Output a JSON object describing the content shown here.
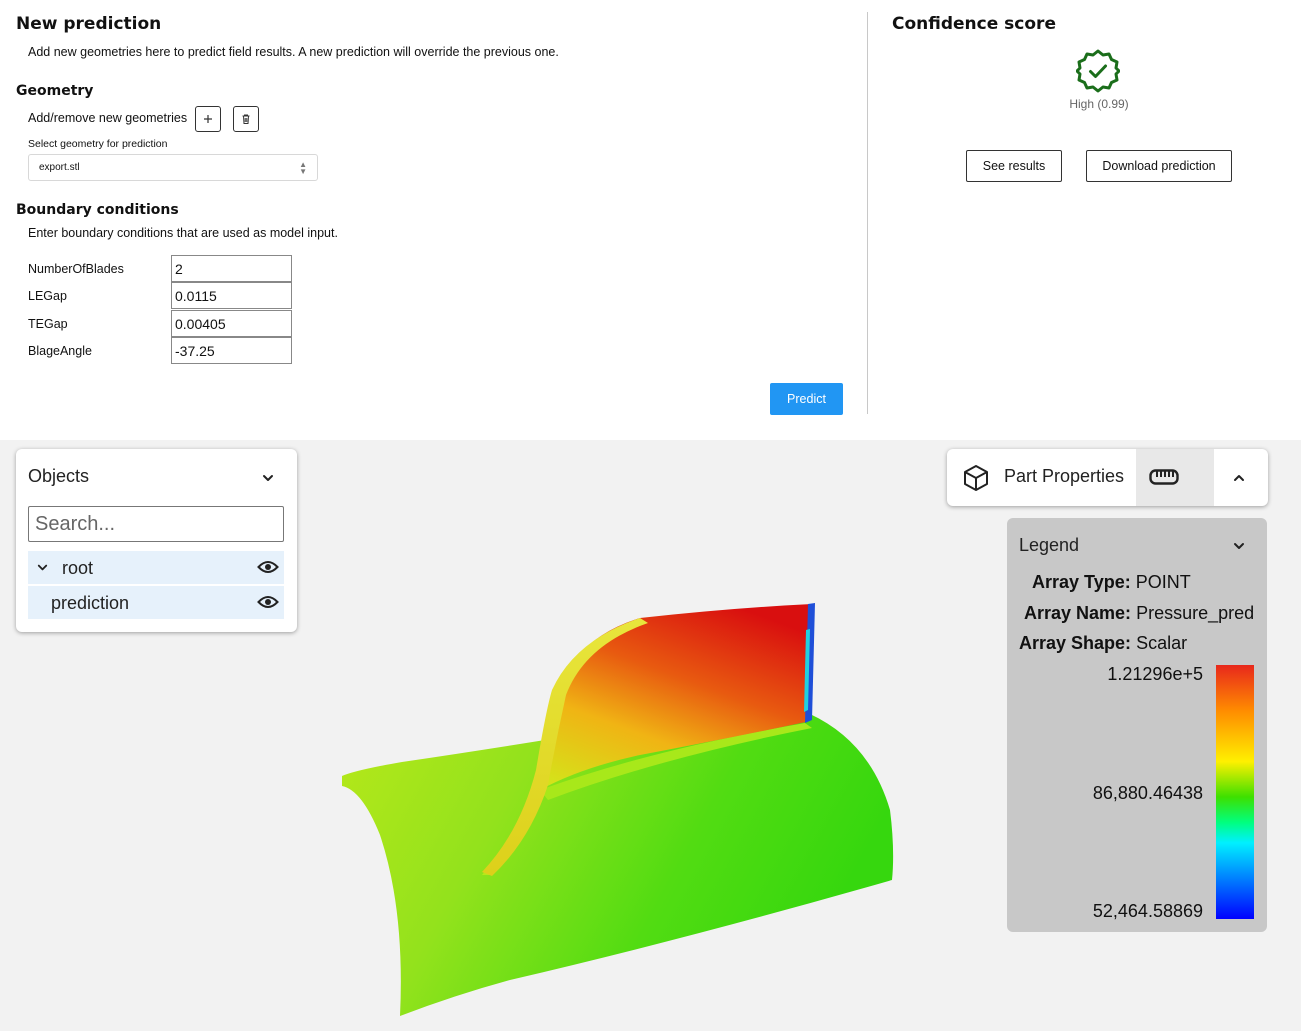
{
  "new_prediction": {
    "title": "New prediction",
    "description": "Add new geometries here to predict field results. A new prediction will override the previous one."
  },
  "geometry": {
    "title": "Geometry",
    "add_remove_label": "Add/remove new geometries",
    "add_icon": "plus-icon",
    "remove_icon": "trash-icon",
    "select_label": "Select geometry for prediction",
    "selected_value": "export.stl"
  },
  "boundary": {
    "title": "Boundary conditions",
    "description": "Enter boundary conditions that are used as model input.",
    "fields": [
      {
        "label": "NumberOfBlades",
        "value": "2"
      },
      {
        "label": "LEGap",
        "value": "0.0115"
      },
      {
        "label": "TEGap",
        "value": "0.00405"
      },
      {
        "label": "BlageAngle",
        "value": "-37.25"
      }
    ],
    "predict_label": "Predict"
  },
  "confidence": {
    "title": "Confidence score",
    "icon": "verified-badge-icon",
    "score_text": "High (0.99)",
    "see_results_label": "See results",
    "download_label": "Download prediction"
  },
  "objects_panel": {
    "title": "Objects",
    "search_placeholder": "Search...",
    "tree": [
      {
        "label": "root",
        "expanded": true
      },
      {
        "label": "prediction"
      }
    ]
  },
  "part_properties": {
    "title": "Part Properties",
    "icon": "cube-icon",
    "tab_icon": "ruler-icon"
  },
  "legend": {
    "title": "Legend",
    "array_type_label": "Array Type:",
    "array_type": "POINT",
    "array_name_label": "Array Name:",
    "array_name": "Pressure_pred",
    "array_shape_label": "Array Shape:",
    "array_shape": "Scalar",
    "max_value": "1.21296e+5",
    "mid_value": "86,880.46438",
    "min_value": "52,464.58869"
  },
  "colors": {
    "accent": "#2196f3",
    "confidence_green": "#1b6e1b",
    "viewer_bg": "#f2f2f2",
    "legend_bg": "#c8c8c8"
  }
}
